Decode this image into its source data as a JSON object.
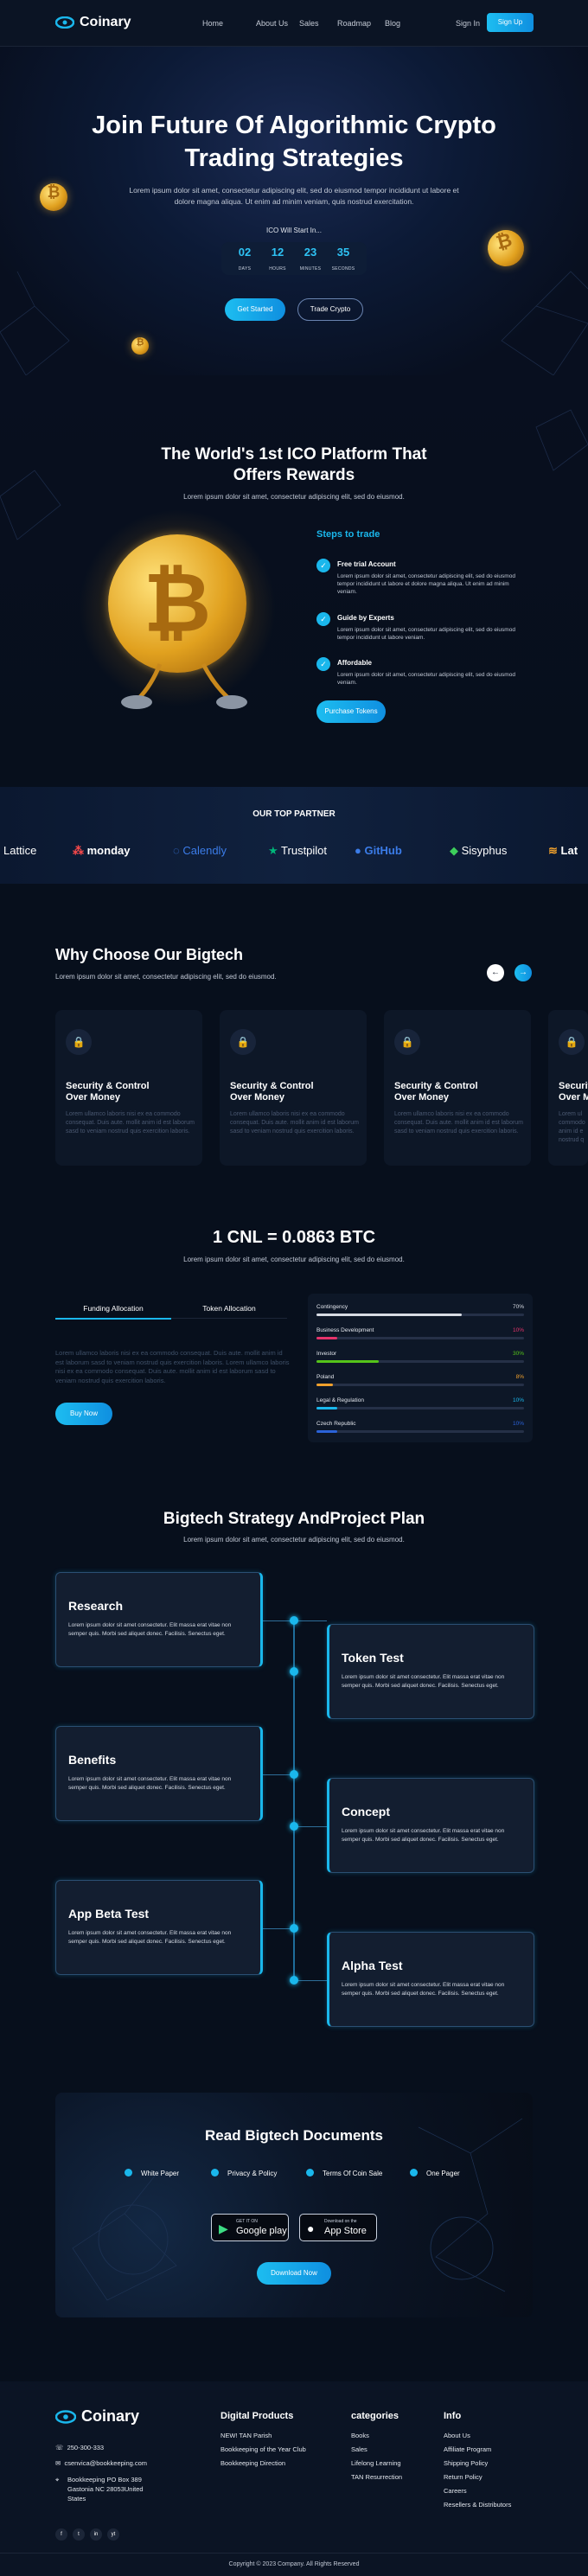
{
  "nav": {
    "brand": "Coinary",
    "links": [
      "Home",
      "About Us",
      "Sales",
      "Roadmap",
      "Blog"
    ],
    "signin": "Sign In",
    "signup": "Sign Up"
  },
  "hero": {
    "title_line1": "Join Future Of Algorithmic Crypto",
    "title_line2": "Trading Strategies",
    "desc_line1": "Lorem ipsum dolor sit amet, consectetur adipiscing elit, sed do eiusmod tempor incididunt ut labore et",
    "desc_line2": "dolore magna aliqua. Ut enim ad minim veniam, quis nostrud exercitation.",
    "ico_label": "ICO Will Start In...",
    "countdown": [
      {
        "value": "02",
        "unit": "DAYS"
      },
      {
        "value": "12",
        "unit": "HOURS"
      },
      {
        "value": "23",
        "unit": "MINUTES"
      },
      {
        "value": "35",
        "unit": "SECONDS"
      }
    ],
    "cta_primary": "Get Started",
    "cta_secondary": "Trade Crypto"
  },
  "ico": {
    "title_line1": "The World's 1st ICO Platform That",
    "title_line2": "Offers Rewards",
    "subtitle": "Lorem ipsum dolor sit amet, consectetur adipiscing elit, sed do eiusmod.",
    "steps_heading": "Steps to trade",
    "steps": [
      {
        "title": "Free trial Account",
        "text": "Lorem ipsum dolor sit amet, consectetur adipiscing elit, sed do eiusmod tempor incididunt ut labore et dolore magna aliqua. Ut enim ad minim veniam."
      },
      {
        "title": "Guide by Experts",
        "text": "Lorem ipsum dolor sit amet, consectetur adipiscing elit, sed do eiusmod tempor incididunt ut labore veniam."
      },
      {
        "title": "Affordable",
        "text": "Lorem ipsum dolor sit amet, consectetur adipiscing elit, sed do eiusmod veniam."
      }
    ],
    "cta": "Purchase Tokens"
  },
  "partners": {
    "heading": "OUR TOP PARTNER",
    "logos": [
      "Lattice",
      "monday",
      "Calendly",
      "Trustpilot",
      "GitHub",
      "Sisyphus",
      "Lat"
    ]
  },
  "why": {
    "title": "Why Choose Our Bigtech",
    "subtitle": "Lorem ipsum dolor sit amet, consectetur adipiscing elit, sed do eiusmod.",
    "prev": "←",
    "next": "→",
    "cards": [
      {
        "title_l1": "Security & Control",
        "title_l2": "Over Money",
        "text": "Lorem ullamco laboris nisi ex ea commodo consequat. Duis aute. mollit anim id est laborum sasd to veniam nostrud quis exercition laboris."
      },
      {
        "title_l1": "Security & Control",
        "title_l2": "Over Money",
        "text": "Lorem ullamco laboris nisi ex ea commodo consequat. Duis aute. mollit anim id est laborum sasd to veniam nostrud quis exercition laboris."
      },
      {
        "title_l1": "Security & Control",
        "title_l2": "Over Money",
        "text": "Lorem ullamco laboris nisi ex ea commodo consequat. Duis aute. mollit anim id est laborum sasd to veniam nostrud quis exercition laboris."
      },
      {
        "title_l1": "Securit",
        "title_l2": "Over M",
        "text": "Lorem ul commodo anim id e nostrud q"
      }
    ]
  },
  "token": {
    "title": "1 CNL = 0.0863 BTC",
    "subtitle": "Lorem ipsum dolor sit amet, consectetur adipiscing elit, sed do eiusmod.",
    "tab_active": "Funding Allocation",
    "tab_inactive": "Token Allocation",
    "text": "Lorem ullamco laboris nisi ex ea commodo consequat. Duis aute. mollit anim id est laborum sasd to veniam nostrud quis exercition laboris. Lorem ullamco laboris nisi ex ea commodo consequat. Duis aute. mollit anim id est laborum sasd to veniam nostrud quis exercition laboris.",
    "cta": "Buy Now",
    "bars": [
      {
        "name": "Contingency",
        "percent": "70%",
        "value": 0.7,
        "color": "#d7dbe3"
      },
      {
        "name": "Business Development",
        "percent": "10%",
        "value": 0.1,
        "color": "#e5336b"
      },
      {
        "name": "Investor",
        "percent": "30%",
        "value": 0.3,
        "color": "#55c41a"
      },
      {
        "name": "Poland",
        "percent": "8%",
        "value": 0.08,
        "color": "#f0a02c"
      },
      {
        "name": "Legal & Regulation",
        "percent": "10%",
        "value": 0.1,
        "color": "#1ab7ec"
      },
      {
        "name": "Czech Republic",
        "percent": "10%",
        "value": 0.1,
        "color": "#2b62d8"
      }
    ]
  },
  "roadmap": {
    "title": "Bigtech Strategy AndProject Plan",
    "subtitle": "Lorem ipsum dolor sit amet, consectetur adipiscing elit, sed do eiusmod.",
    "items": [
      {
        "title": "Research",
        "text": "Lorem ipsum dolor sit amet consectetur. Elit massa erat vitae non semper quis. Morbi sed aliquet donec. Facilisis. Senectus eget."
      },
      {
        "title": "Token Test",
        "text": "Lorem ipsum dolor sit amet consectetur. Elit massa erat vitae non semper quis. Morbi sed aliquet donec. Facilisis. Senectus eget."
      },
      {
        "title": "Benefits",
        "text": "Lorem ipsum dolor sit amet consectetur. Elit massa erat vitae non semper quis. Morbi sed aliquet donec. Facilisis. Senectus eget."
      },
      {
        "title": "Concept",
        "text": "Lorem ipsum dolor sit amet consectetur. Elit massa erat vitae non semper quis. Morbi sed aliquet donec. Facilisis. Senectus eget."
      },
      {
        "title": "App Beta Test",
        "text": "Lorem ipsum dolor sit amet consectetur. Elit massa erat vitae non semper quis. Morbi sed aliquet donec. Facilisis. Senectus eget."
      },
      {
        "title": "Alpha Test",
        "text": "Lorem ipsum dolor sit amet consectetur. Elit massa erat vitae non semper quis. Morbi sed aliquet donec. Facilisis. Senectus eget."
      }
    ]
  },
  "docs": {
    "title": "Read Bigtech Documents",
    "links": [
      "White Paper",
      "Privacy & Policy",
      "Terms Of Coin Sale",
      "One Pager"
    ],
    "google_small": "GET IT ON",
    "google_big": "Google play",
    "apple_small": "Download on the",
    "apple_big": "App Store",
    "cta": "Download Now"
  },
  "footer": {
    "brand": "Coinary",
    "phone": "250-300-333",
    "email": "csenvica@bookkeeping.com",
    "address_l1": "Bookkeeping PO Box 389",
    "address_l2": "Gastonia NC 28053United",
    "address_l3": "States",
    "col1_title": "Digital Products",
    "col1": [
      "NEW! TAN Parish",
      "Bookkeeping of the Year Club",
      "Bookkeeping Direction"
    ],
    "col2_title": "categories",
    "col2": [
      "Books",
      "Sales",
      "Lifelong Learning",
      "TAN Resurrection"
    ],
    "col3_title": "Info",
    "col3": [
      "About Us",
      "Affiliate Program",
      "Shipping Policy",
      "Return Policy",
      "Careers",
      "Resellers & Distributors"
    ],
    "social": [
      "f",
      "t",
      "in",
      "yt"
    ],
    "copyright": "Copyright © 2023 Company. All Rights Reserved"
  }
}
